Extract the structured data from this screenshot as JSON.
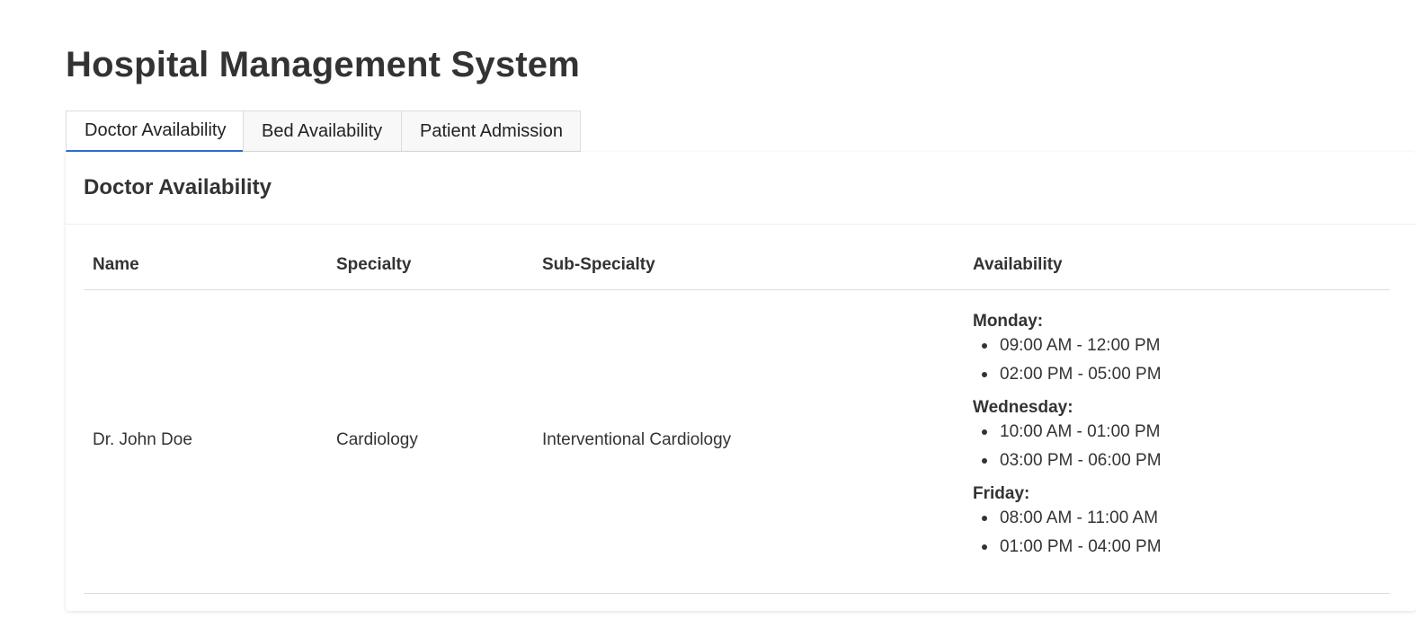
{
  "page": {
    "title": "Hospital Management System"
  },
  "tabs": [
    {
      "label": "Doctor Availability",
      "active": true
    },
    {
      "label": "Bed Availability",
      "active": false
    },
    {
      "label": "Patient Admission",
      "active": false
    }
  ],
  "card": {
    "title": "Doctor Availability"
  },
  "table": {
    "headers": {
      "name": "Name",
      "specialty": "Specialty",
      "sub_specialty": "Sub-Specialty",
      "availability": "Availability"
    },
    "rows": [
      {
        "name": "Dr. John Doe",
        "specialty": "Cardiology",
        "sub_specialty": "Interventional Cardiology",
        "availability": [
          {
            "day": "Monday:",
            "slots": [
              "09:00 AM - 12:00 PM",
              "02:00 PM - 05:00 PM"
            ]
          },
          {
            "day": "Wednesday:",
            "slots": [
              "10:00 AM - 01:00 PM",
              "03:00 PM - 06:00 PM"
            ]
          },
          {
            "day": "Friday:",
            "slots": [
              "08:00 AM - 11:00 AM",
              "01:00 PM - 04:00 PM"
            ]
          }
        ]
      }
    ]
  },
  "colors": {
    "accent": "#2f6fd6",
    "text": "#333333",
    "border": "#dddddd"
  }
}
